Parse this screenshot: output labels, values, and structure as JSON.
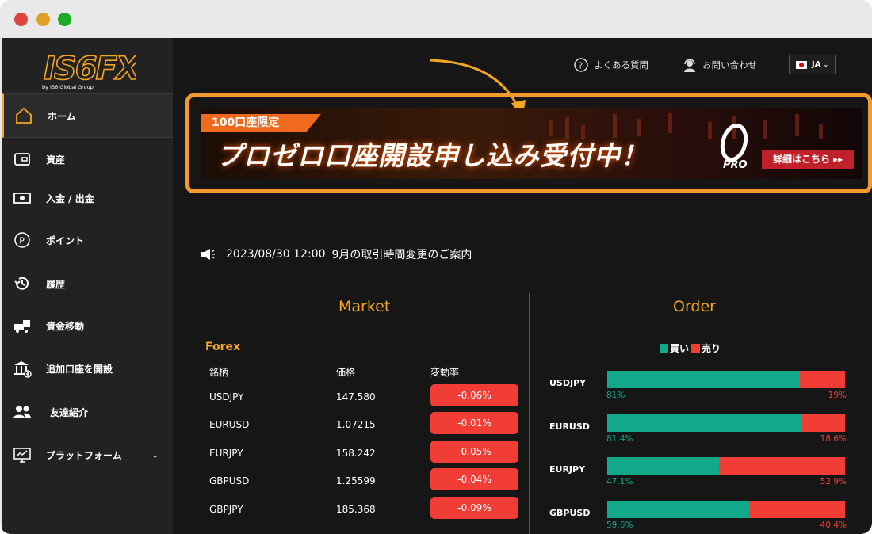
{
  "logo": {
    "text": "IS6FX",
    "sub": "by IS6 Global Group"
  },
  "sidebar": {
    "items": [
      {
        "label": "ホーム",
        "icon": "home-icon"
      },
      {
        "label": "資産",
        "icon": "wallet-icon"
      },
      {
        "label": "入金 / 出金",
        "icon": "cash-icon"
      },
      {
        "label": "ポイント",
        "icon": "points-icon"
      },
      {
        "label": "履歴",
        "icon": "history-icon"
      },
      {
        "label": "資金移動",
        "icon": "transfer-icon"
      },
      {
        "label": "追加口座を開設",
        "icon": "bank-icon"
      },
      {
        "label": "友達紹介",
        "icon": "friends-icon"
      },
      {
        "label": "プラットフォーム",
        "icon": "monitor-icon"
      }
    ]
  },
  "header": {
    "faq_label": "よくある質問",
    "contact_label": "お問い合わせ",
    "language": "JA"
  },
  "banner": {
    "tag": "100口座限定",
    "headline": "プロゼロ口座開設申し込み受付中！",
    "cta": "詳細はこちら ▸▸",
    "logo_text": "PRO"
  },
  "news": {
    "date": "2023/08/30 12:00",
    "title": "9月の取引時間変更のご案内"
  },
  "market": {
    "title": "Market",
    "section": "Forex",
    "headers": {
      "symbol": "銘柄",
      "price": "価格",
      "change": "変動率"
    },
    "rows": [
      {
        "symbol": "USDJPY",
        "price": "147.580",
        "change": "-0.06%"
      },
      {
        "symbol": "EURUSD",
        "price": "1.07215",
        "change": "-0.01%"
      },
      {
        "symbol": "EURJPY",
        "price": "158.242",
        "change": "-0.05%"
      },
      {
        "symbol": "GBPUSD",
        "price": "1.25599",
        "change": "-0.04%"
      },
      {
        "symbol": "GBPJPY",
        "price": "185.368",
        "change": "-0.09%"
      }
    ]
  },
  "order": {
    "title": "Order",
    "legend_buy": "買い",
    "legend_sell": "売り",
    "colors": {
      "buy": "#12a88a",
      "sell": "#f13d35"
    },
    "rows": [
      {
        "symbol": "USDJPY",
        "buy": 81,
        "buy_label": "81%",
        "sell_label": "19%"
      },
      {
        "symbol": "EURUSD",
        "buy": 81.4,
        "buy_label": "81.4%",
        "sell_label": "18.6%"
      },
      {
        "symbol": "EURJPY",
        "buy": 47.1,
        "buy_label": "47.1%",
        "sell_label": "52.9%"
      },
      {
        "symbol": "GBPUSD",
        "buy": 59.6,
        "buy_label": "59.6%",
        "sell_label": "40.4%"
      }
    ]
  },
  "colors": {
    "accent": "#f5a623",
    "negative": "#f13d35",
    "positive": "#12a88a",
    "highlight": "#f29a2e"
  }
}
